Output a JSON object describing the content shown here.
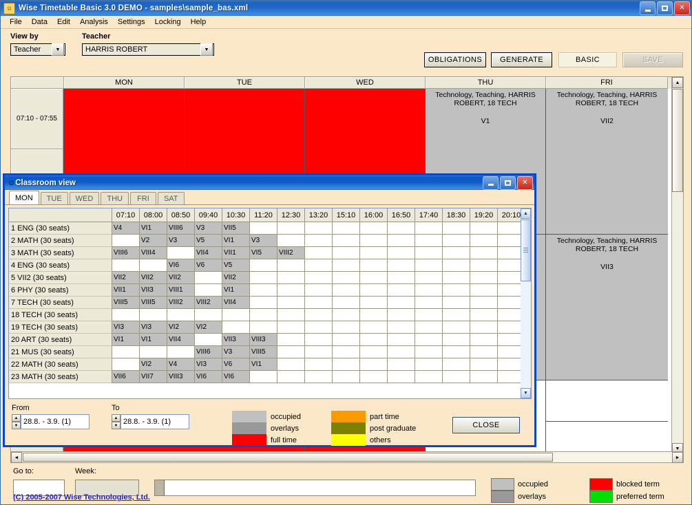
{
  "window": {
    "title": "Wise Timetable Basic 3.0 DEMO - samples\\sample_bas.xml",
    "icon": "app-face-icon",
    "minimize": "_",
    "maximize": "□",
    "close": "✕"
  },
  "menu": [
    "File",
    "Data",
    "Edit",
    "Analysis",
    "Settings",
    "Locking",
    "Help"
  ],
  "toolbar": {
    "view_by_label": "View by",
    "view_by_value": "Teacher",
    "teacher_label": "Teacher",
    "teacher_value": "HARRIS ROBERT",
    "obligations": "OBLIGATIONS",
    "generate": "GENERATE",
    "basic": "BASIC",
    "save": "SAVE"
  },
  "main_grid": {
    "days": [
      "MON",
      "TUE",
      "WED",
      "THU",
      "FRI"
    ],
    "time_slots": [
      "07:10 - 07:55",
      "",
      "",
      "",
      "",
      ""
    ],
    "lesson_text": "Technology, Teaching, HARRIS ROBERT, 18 TECH",
    "cells": [
      {
        "day": "THU",
        "room": "V1"
      },
      {
        "day": "FRI",
        "room": "VII2"
      },
      {
        "day": "FRI",
        "room": "VII3"
      }
    ],
    "blocked_color": "#ff0000",
    "occupied_color": "#c0c0c0"
  },
  "status": {
    "goto_label": "Go to:",
    "goto_value": "",
    "week_label": "Week:",
    "week_value": "",
    "legend": [
      {
        "label": "occupied",
        "color": "#c0c0c0"
      },
      {
        "label": "overlays",
        "color": "#999999"
      },
      {
        "label": "blocked term",
        "color": "#ff0000"
      },
      {
        "label": "preferred term",
        "color": "#00e000"
      }
    ],
    "copyright": "(C) 2005-2007 Wise Technologies, Ltd."
  },
  "dialog": {
    "title": "Classroom view",
    "icon": "app-face-icon",
    "minimize": "_",
    "maximize": "□",
    "close": "✕",
    "tabs": [
      {
        "label": "MON",
        "active": true
      },
      {
        "label": "TUE",
        "active": false
      },
      {
        "label": "WED",
        "active": false
      },
      {
        "label": "THU",
        "active": false
      },
      {
        "label": "FRI",
        "active": false
      },
      {
        "label": "SAT",
        "active": false
      }
    ],
    "times": [
      "07:10",
      "08:00",
      "08:50",
      "09:40",
      "10:30",
      "11:20",
      "12:30",
      "13:20",
      "15:10",
      "16:00",
      "16:50",
      "17:40",
      "18:30",
      "19:20",
      "20:10"
    ],
    "rows": [
      {
        "room": "1 ENG (30 seats)",
        "cells": [
          "V4",
          "VI1",
          "VIII6",
          "V3",
          "VII5",
          "",
          "",
          "",
          "",
          "",
          "",
          "",
          "",
          "",
          ""
        ]
      },
      {
        "room": "2 MATH (30 seats)",
        "cells": [
          "",
          "V2",
          "V3",
          "V5",
          "VI1",
          "V3",
          "",
          "",
          "",
          "",
          "",
          "",
          "",
          "",
          ""
        ]
      },
      {
        "room": "3 MATH (30 seats)",
        "cells": [
          "VIII6",
          "VIII4",
          "",
          "VII4",
          "VII1",
          "VI5",
          "VIII2",
          "",
          "",
          "",
          "",
          "",
          "",
          "",
          ""
        ]
      },
      {
        "room": "4 ENG (30 seats)",
        "cells": [
          "",
          "",
          "VI6",
          "V6",
          "V5",
          "",
          "",
          "",
          "",
          "",
          "",
          "",
          "",
          "",
          ""
        ]
      },
      {
        "room": "5 VII2 (30 seats)",
        "cells": [
          "VII2",
          "VII2",
          "VII2",
          "",
          "VII2",
          "",
          "",
          "",
          "",
          "",
          "",
          "",
          "",
          "",
          ""
        ]
      },
      {
        "room": "6 PHY (30 seats)",
        "cells": [
          "VII1",
          "VII3",
          "VIII1",
          "",
          "VI1",
          "",
          "",
          "",
          "",
          "",
          "",
          "",
          "",
          "",
          ""
        ]
      },
      {
        "room": "7 TECH (30 seats)",
        "cells": [
          "VIII5",
          "VIII5",
          "VIII2",
          "VIII2",
          "VII4",
          "",
          "",
          "",
          "",
          "",
          "",
          "",
          "",
          "",
          ""
        ]
      },
      {
        "room": "18 TECH (30 seats)",
        "cells": [
          "",
          "",
          "",
          "",
          "",
          "",
          "",
          "",
          "",
          "",
          "",
          "",
          "",
          "",
          ""
        ]
      },
      {
        "room": "19 TECH (30 seats)",
        "cells": [
          "VI3",
          "VI3",
          "VI2",
          "VI2",
          "",
          "",
          "",
          "",
          "",
          "",
          "",
          "",
          "",
          "",
          ""
        ]
      },
      {
        "room": "20 ART (30 seats)",
        "cells": [
          "VI1",
          "VI1",
          "VII4",
          "",
          "VII3",
          "VIII3",
          "",
          "",
          "",
          "",
          "",
          "",
          "",
          "",
          ""
        ]
      },
      {
        "room": "21 MUS (30 seats)",
        "cells": [
          "",
          "",
          "",
          "VIII6",
          "V3",
          "VIII5",
          "",
          "",
          "",
          "",
          "",
          "",
          "",
          "",
          ""
        ]
      },
      {
        "room": "22 MATH (30 seats)",
        "cells": [
          "",
          "VI2",
          "V4",
          "VI3",
          "V6",
          "VI1",
          "",
          "",
          "",
          "",
          "",
          "",
          "",
          "",
          ""
        ]
      },
      {
        "room": "23 MATH (30 seats)",
        "cells": [
          "VII6",
          "VII7",
          "VIII3",
          "VI6",
          "VI6",
          "",
          "",
          "",
          "",
          "",
          "",
          "",
          "",
          "",
          ""
        ]
      }
    ],
    "from_label": "From",
    "from_value": "28.8. - 3.9. (1)",
    "to_label": "To",
    "to_value": "28.8. - 3.9. (1)",
    "legend_left": [
      {
        "label": "occupied",
        "color": "#c0c0c0"
      },
      {
        "label": "overlays",
        "color": "#999999"
      },
      {
        "label": "full time",
        "color": "#ff0000"
      }
    ],
    "legend_right": [
      {
        "label": "part time",
        "color": "#ff9900"
      },
      {
        "label": "post graduate",
        "color": "#808000"
      },
      {
        "label": "others",
        "color": "#ffff00"
      }
    ],
    "close_button": "CLOSE"
  }
}
